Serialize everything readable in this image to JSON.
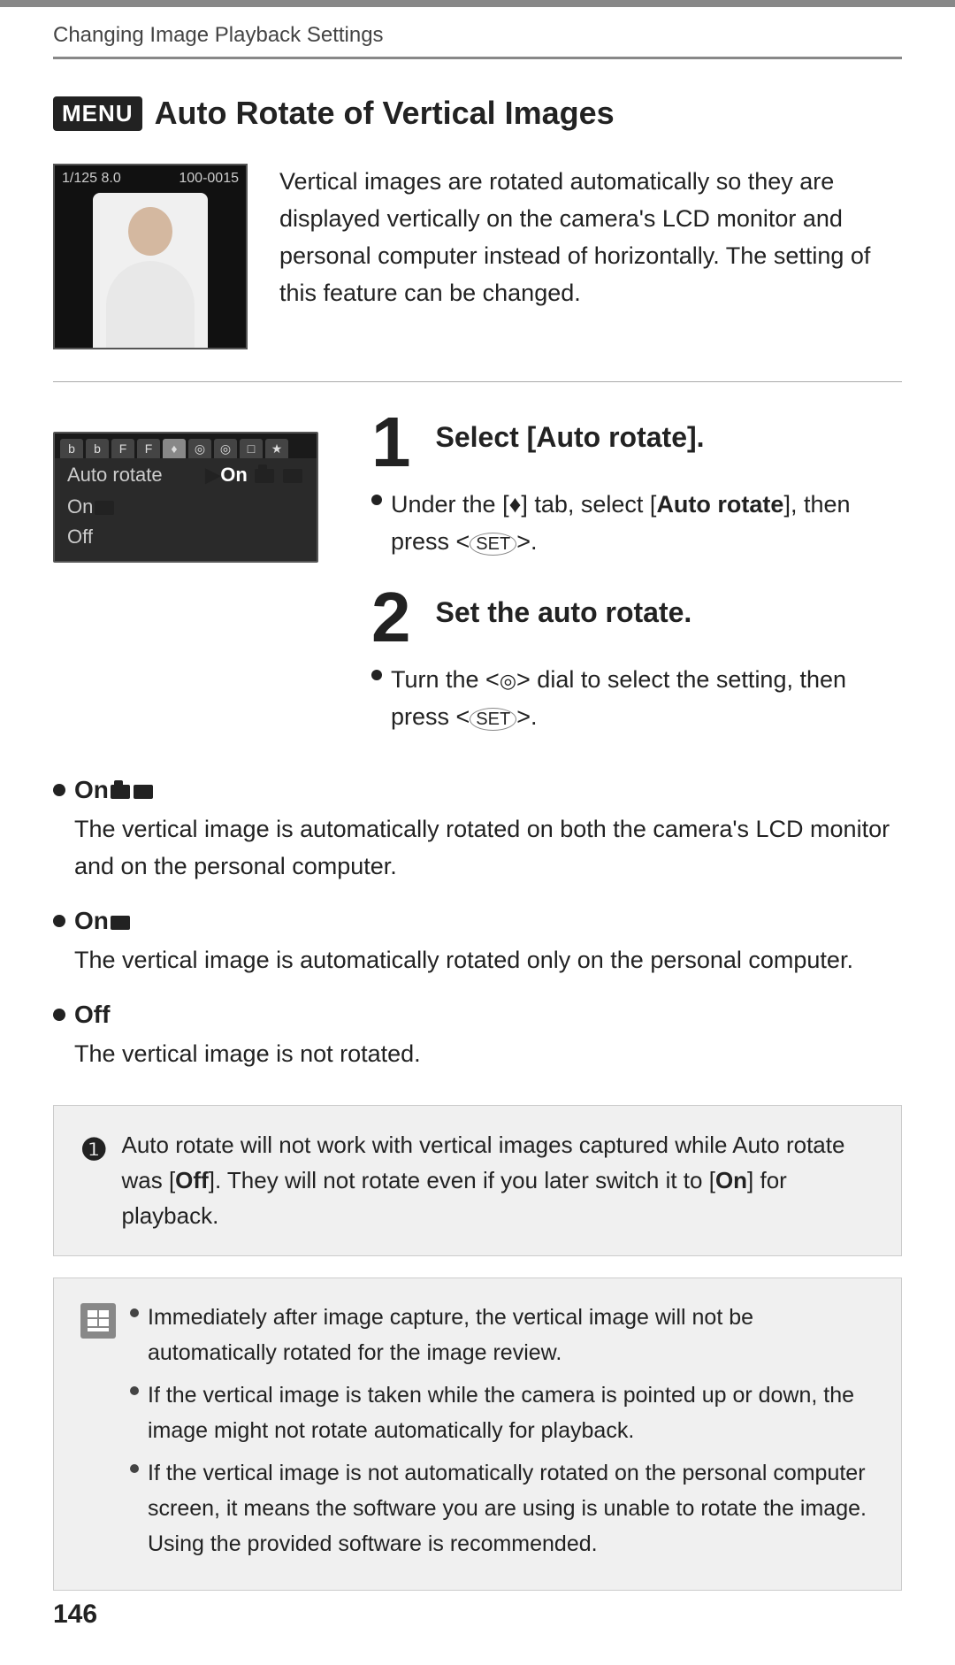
{
  "breadcrumb": "Changing Image Playback Settings",
  "top_divider_visible": true,
  "section": {
    "menu_badge": "MENU",
    "title": "Auto Rotate of Vertical Images",
    "intro_text": "Vertical images are rotated automatically so they are displayed vertically on the camera's LCD monitor and personal computer instead of horizontally. The setting of this feature can be changed.",
    "camera_info_left": "1/125  8.0",
    "camera_info_right": "100-0015"
  },
  "step1": {
    "number": "1",
    "title": "Select [Auto rotate].",
    "bullet": "Under the [♦] tab, select [Auto rotate], then press <(SET)>."
  },
  "step2": {
    "number": "2",
    "title": "Set the auto rotate.",
    "bullet": "Turn the <◎> dial to select the setting, then press <(SET)>."
  },
  "menu_ui": {
    "tabs": [
      "b",
      "b",
      "F",
      "F",
      "♦",
      "◎",
      "◎",
      "□",
      "★"
    ],
    "row_label": "Auto rotate",
    "row_value": "▶On",
    "options": [
      "On▣■",
      "On■",
      "Off"
    ]
  },
  "bullets": [
    {
      "id": "on-cam-monitor",
      "heading": "On",
      "icons": "📷 🖥",
      "body": "The vertical image is automatically rotated on both the camera's LCD monitor and on the personal computer."
    },
    {
      "id": "on-monitor",
      "heading": "On",
      "icons": "🖥",
      "body": "The vertical image is automatically rotated only on the personal computer."
    },
    {
      "id": "off",
      "heading": "Off",
      "icons": "",
      "body": "The vertical image is not rotated."
    }
  ],
  "warning": {
    "icon": "⓿",
    "text": "Auto rotate will not work with vertical images captured while Auto rotate was [Off]. They will not rotate even if you later switch it to [On] for playback."
  },
  "notes": [
    "Immediately after image capture, the vertical image will not be automatically rotated for the image review.",
    "If the vertical image is taken while the camera is pointed up or down, the image might not rotate automatically for playback.",
    "If the vertical image is not automatically rotated on the personal computer screen, it means the software you are using is unable to rotate the image. Using the provided software is recommended."
  ],
  "page_number": "146"
}
